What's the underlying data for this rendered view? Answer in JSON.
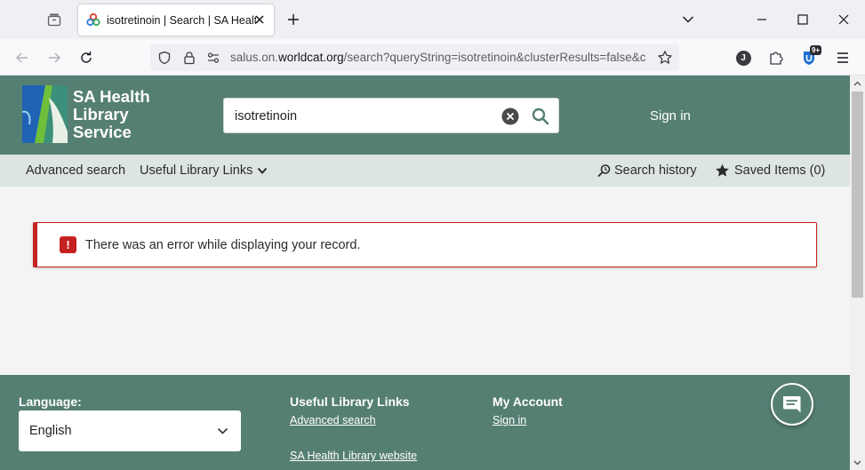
{
  "browser": {
    "tab": {
      "title": "isotretinoin | Search | SA Health"
    },
    "url": {
      "prefix": "salus.on.",
      "host": "worldcat.org",
      "path": "/search?queryString=isotretinoin&clusterResults=false&c"
    },
    "profile_initial": "J",
    "extension_badge": "9+"
  },
  "header": {
    "logo_line1": "SA Health",
    "logo_line2": "Library",
    "logo_line3": "Service",
    "search_value": "isotretinoin",
    "sign_in_label": "Sign in"
  },
  "subnav": {
    "advanced_search": "Advanced search",
    "useful_links": "Useful Library Links",
    "search_history": "Search history",
    "saved_items": "Saved Items (0)"
  },
  "alert": {
    "icon_glyph": "!",
    "message": "There was an error while displaying your record."
  },
  "footer": {
    "language_heading": "Language:",
    "language_value": "English",
    "useful_links_heading": "Useful Library Links",
    "advanced_search_link": "Advanced search",
    "sa_health_website_link": "SA Health Library website",
    "my_account_heading": "My Account",
    "sign_in_link": "Sign in"
  },
  "colors": {
    "brand_green": "#567f74",
    "subnav_bg": "#dde5e2",
    "error_red": "#c5221f"
  },
  "icons": {
    "tab_side": "sidebar-tabs-icon",
    "favicon": "worldcat-favicon",
    "close": "close-icon",
    "new_tab": "plus-icon",
    "list_tabs": "chevron-down-icon",
    "back": "back-arrow-icon",
    "forward": "forward-arrow-icon",
    "reload": "reload-icon",
    "shield": "tracking-shield-icon",
    "lock": "lock-icon",
    "permissions": "permissions-icon",
    "bookmark": "star-icon",
    "extensions": "puzzle-icon",
    "menu": "hamburger-menu-icon",
    "search": "search-icon",
    "clear": "clear-search-icon",
    "history": "search-history-icon",
    "saved": "star-filled-icon",
    "chat": "chat-icon"
  }
}
